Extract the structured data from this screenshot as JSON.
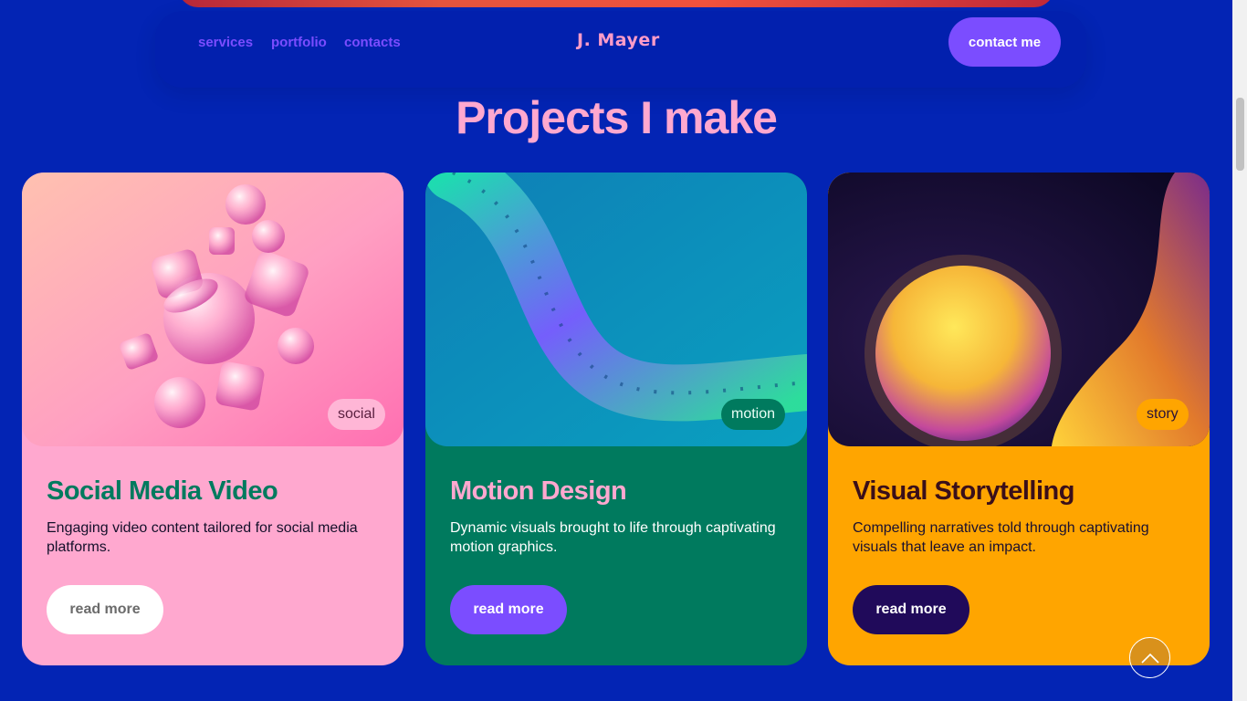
{
  "nav": {
    "links": [
      "services",
      "portfolio",
      "contacts"
    ],
    "logo": "J. Mayer",
    "contact_button": "contact me"
  },
  "section": {
    "title": "Projects I make"
  },
  "cards": [
    {
      "tag": "social",
      "title": "Social Media Video",
      "description": "Engaging video content tailored for social media platforms.",
      "button": "read more"
    },
    {
      "tag": "motion",
      "title": "Motion Design",
      "description": "Dynamic visuals brought to life through captivating motion graphics.",
      "button": "read more"
    },
    {
      "tag": "story",
      "title": "Visual Storytelling",
      "description": "Compelling narratives told through captivating visuals that leave an impact.",
      "button": "read more"
    }
  ],
  "icons": {
    "scroll_top": "chevron-up-icon"
  },
  "colors": {
    "page_bg": "#0324b4",
    "accent_purple": "#7b4dff",
    "pink": "#ffa8cf",
    "green": "#007a5e",
    "orange": "#ffa500",
    "dark_purple": "#200a5a"
  }
}
